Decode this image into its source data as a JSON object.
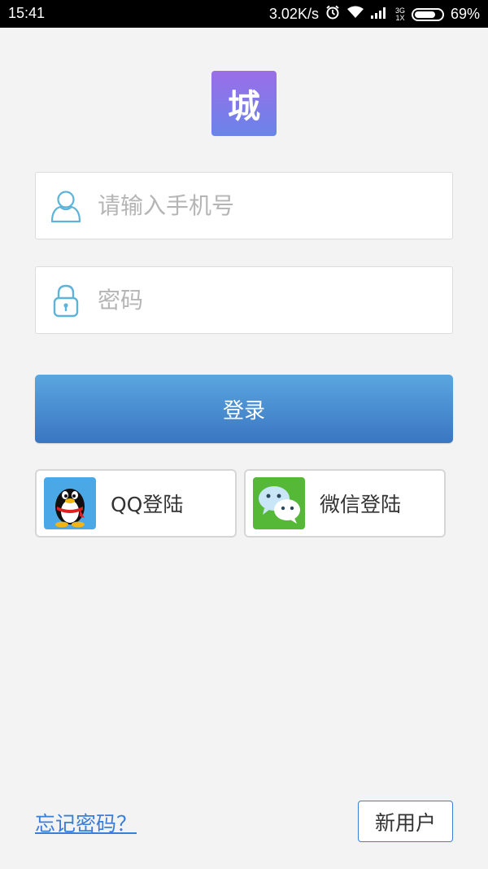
{
  "status_bar": {
    "time": "15:41",
    "speed": "3.02K/s",
    "net_type_top": "3G",
    "net_type_bottom": "1X",
    "battery": "69%",
    "battery_level": 0.69
  },
  "logo": {
    "text": "城",
    "gradient_top": "#9b6ee8",
    "gradient_bottom": "#6a84ea"
  },
  "phone_field": {
    "placeholder": "请输入手机号",
    "icon": "user-icon"
  },
  "password_field": {
    "placeholder": "密码",
    "icon": "lock-icon"
  },
  "login_button": {
    "label": "登录",
    "color": "#4a8ad2"
  },
  "social": {
    "qq": {
      "label": "QQ登陆",
      "icon": "qq-penguin-icon"
    },
    "wechat": {
      "label": "微信登陆",
      "icon": "wechat-icon"
    }
  },
  "footer": {
    "forgot": "忘记密码？",
    "new_user": "新用户"
  }
}
